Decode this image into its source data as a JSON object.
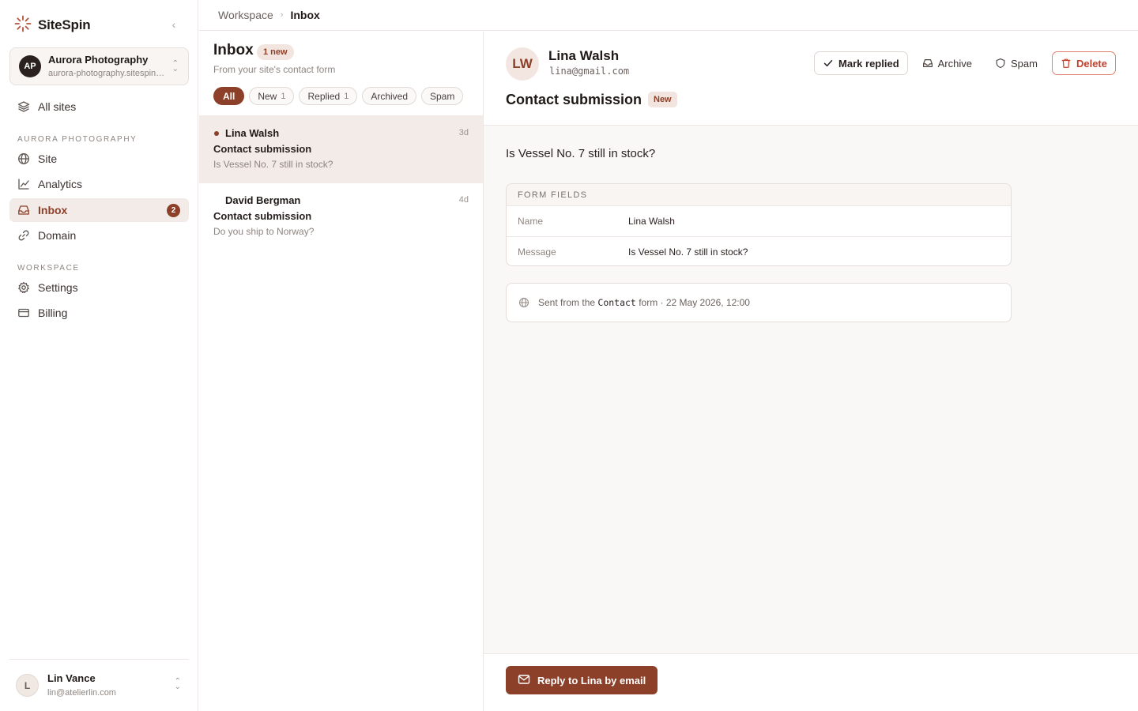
{
  "app": {
    "name": "SiteSpin"
  },
  "site": {
    "initials": "AP",
    "name": "Aurora Photography",
    "url": "aurora-photography.sitespin.app"
  },
  "nav": {
    "all_sites": "All sites",
    "site_section_label": "Aurora Photography",
    "site_items": [
      {
        "label": "Site",
        "icon": "globe-icon"
      },
      {
        "label": "Analytics",
        "icon": "chart-line-icon"
      },
      {
        "label": "Inbox",
        "icon": "inbox-icon",
        "badge": "2",
        "active": true
      },
      {
        "label": "Domain",
        "icon": "link-icon"
      }
    ],
    "workspace_section_label": "Workspace",
    "workspace_items": [
      {
        "label": "Settings",
        "icon": "gear-icon"
      },
      {
        "label": "Billing",
        "icon": "credit-card-icon"
      }
    ]
  },
  "user": {
    "initial": "L",
    "name": "Lin Vance",
    "email": "lin@atelierlin.com"
  },
  "breadcrumb": {
    "parent": "Workspace",
    "current": "Inbox"
  },
  "inbox": {
    "title": "Inbox",
    "new_pill": "1 new",
    "subtitle": "From your site's contact form",
    "filters": [
      {
        "label": "All",
        "count": "",
        "active": true
      },
      {
        "label": "New",
        "count": "1"
      },
      {
        "label": "Replied",
        "count": "1"
      },
      {
        "label": "Archived",
        "count": ""
      },
      {
        "label": "Spam",
        "count": ""
      }
    ],
    "messages": [
      {
        "sender": "Lina Walsh",
        "age": "3d",
        "subject": "Contact submission",
        "snippet": "Is Vessel No. 7 still in stock?",
        "unread": true,
        "selected": true
      },
      {
        "sender": "David Bergman",
        "age": "4d",
        "subject": "Contact submission",
        "snippet": "Do you ship to Norway?",
        "unread": false,
        "selected": false
      }
    ]
  },
  "detail": {
    "initials": "LW",
    "name": "Lina Walsh",
    "email": "lina@gmail.com",
    "title": "Contact submission",
    "status_badge": "New",
    "actions": {
      "mark_replied": "Mark replied",
      "archive": "Archive",
      "spam": "Spam",
      "delete": "Delete"
    },
    "message": "Is Vessel No. 7 still in stock?",
    "fields_heading": "Form fields",
    "fields": [
      {
        "key": "Name",
        "value": "Lina Walsh"
      },
      {
        "key": "Message",
        "value": "Is Vessel No. 7 still in stock?"
      }
    ],
    "sent_prefix": "Sent from the",
    "sent_form": "Contact",
    "sent_suffix": "form · 22 May 2026, 12:00",
    "reply_button": "Reply to Lina by email"
  },
  "colors": {
    "accent": "#8c4029",
    "danger": "#c1412c"
  }
}
